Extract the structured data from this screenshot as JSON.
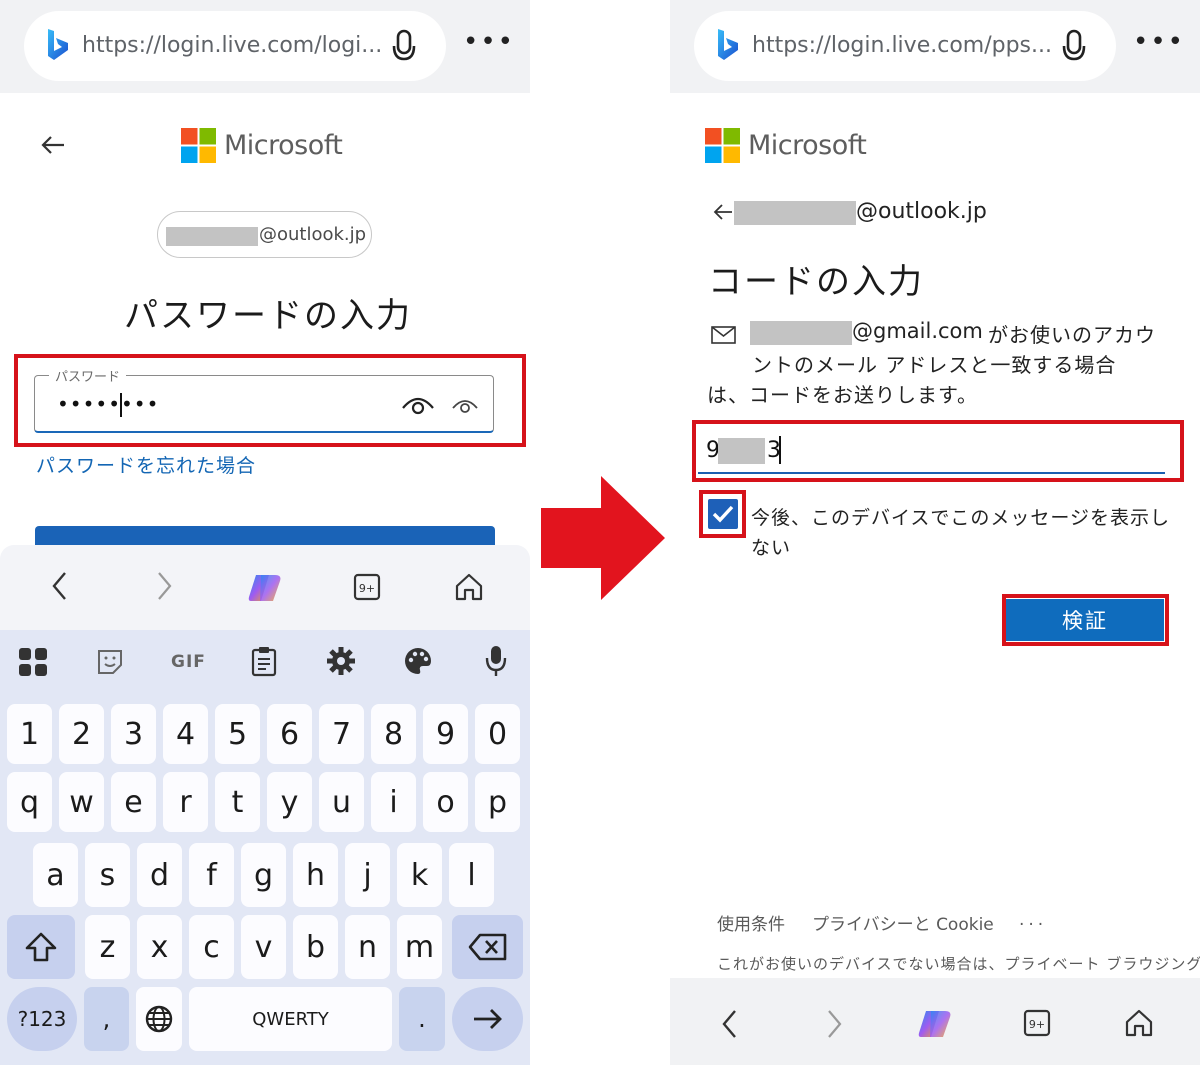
{
  "left": {
    "url": "https://login.live.com/logi...",
    "brand": "Microsoft",
    "account_suffix": "@outlook.jp",
    "title": "パスワードの入力",
    "password_label": "パスワード",
    "password_value": "••••••••",
    "forgot_link": "パスワードを忘れた場合",
    "keyboard": {
      "toolbar_gif": "GIF",
      "row_numbers": [
        "1",
        "2",
        "3",
        "4",
        "5",
        "6",
        "7",
        "8",
        "9",
        "0"
      ],
      "row_q": [
        "q",
        "w",
        "e",
        "r",
        "t",
        "y",
        "u",
        "i",
        "o",
        "p"
      ],
      "row_a": [
        "a",
        "s",
        "d",
        "f",
        "g",
        "h",
        "j",
        "k",
        "l"
      ],
      "row_z": [
        "z",
        "x",
        "c",
        "v",
        "b",
        "n",
        "m"
      ],
      "symbols_key": "?123",
      "comma_key": ",",
      "space_key": "QWERTY",
      "period_key": "."
    }
  },
  "right": {
    "url": "https://login.live.com/pps...",
    "brand": "Microsoft",
    "account_suffix": "@outlook.jp",
    "title": "コードの入力",
    "email_suffix": "@gmail.com",
    "message_line1": "がお使いのアカウ",
    "message_line2": "ントのメール アドレスと一致する場合",
    "message_line3": "は、コードをお送りします。",
    "code_first": "9",
    "code_last": "3",
    "checkbox_label_line1": "今後、このデバイスでこのメッセージを表示し",
    "checkbox_label_line2": "ない",
    "verify_button": "検証",
    "footer_terms": "使用条件",
    "footer_privacy": "プライバシーと Cookie",
    "footer_more": "...",
    "footer_note": "これがお使いのデバイスでない場合は、プライベート ブラウジング"
  },
  "colors": {
    "accent_blue": "#0f6cbd",
    "highlight_red": "#d6121a",
    "keyboard_bg": "#e2e7f5"
  },
  "icons": [
    "bing-logo-icon",
    "microphone-icon",
    "more-icon",
    "microsoft-logo-icon",
    "back-arrow-icon",
    "eye-icon",
    "copilot-icon",
    "tabs-icon",
    "home-icon",
    "mail-icon",
    "checkmark-icon",
    "backspace-icon",
    "shift-icon",
    "globe-icon",
    "enter-arrow-icon"
  ]
}
